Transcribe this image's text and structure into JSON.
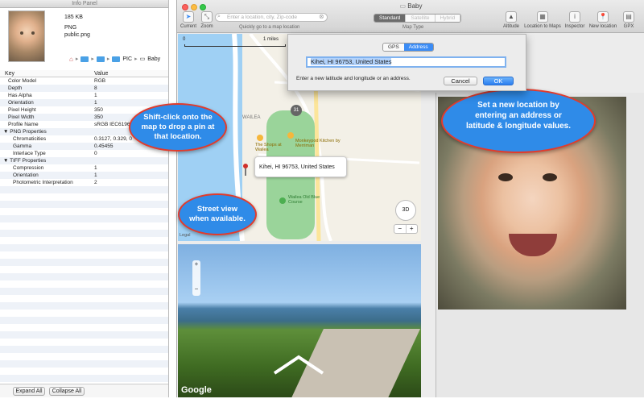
{
  "info_panel": {
    "title": "Info Panel",
    "file_size": "185 KB",
    "file_type": "PNG",
    "file_name": "public.png",
    "path": {
      "folder": "PIC",
      "file": "Baby"
    },
    "headers": {
      "key": "Key",
      "value": "Value"
    },
    "rows": [
      {
        "k": "Color Model",
        "v": "RGB",
        "indent": 1
      },
      {
        "k": "Depth",
        "v": "8",
        "indent": 1
      },
      {
        "k": "Has Alpha",
        "v": "1",
        "indent": 1
      },
      {
        "k": "Orientation",
        "v": "1",
        "indent": 1
      },
      {
        "k": "Pixel Height",
        "v": "350",
        "indent": 1
      },
      {
        "k": "Pixel Width",
        "v": "350",
        "indent": 1
      },
      {
        "k": "Profile Name",
        "v": "sRGB IEC6196",
        "indent": 1
      },
      {
        "k": "▼ PNG Properties",
        "v": "",
        "indent": 0
      },
      {
        "k": "Chromaticities",
        "v": "0.3127, 0.329, 0",
        "indent": 2
      },
      {
        "k": "Gamma",
        "v": "0.45455",
        "indent": 2
      },
      {
        "k": "Interlace Type",
        "v": "0",
        "indent": 2
      },
      {
        "k": "▼ TIFF Properties",
        "v": "",
        "indent": 0
      },
      {
        "k": "Compression",
        "v": "1",
        "indent": 2
      },
      {
        "k": "Orientation",
        "v": "1",
        "indent": 2
      },
      {
        "k": "Photometric Interpretation",
        "v": "2",
        "indent": 2
      }
    ],
    "expand_all": "Expand All",
    "collapse_all": "Collapse All"
  },
  "window": {
    "title": "Baby",
    "toolbar": {
      "current": "Current",
      "zoom": "Zoom",
      "search_placeholder": "Enter a location, city, Zip-code",
      "search_hint": "Quickly go to a map location",
      "map_type_label": "Map Type",
      "map_types": [
        "Standard",
        "Satellite",
        "Hybrid"
      ],
      "altitude": "Altitude",
      "location_to_maps": "Location to Maps",
      "inspector": "Inspector",
      "new_location": "New location",
      "gpx": "GPX"
    }
  },
  "map": {
    "scale_start": "0",
    "scale_end": "1 miles",
    "pin_label": "Kihei, HI  96753, United States",
    "places": [
      "WAILEA",
      "The Shops at Wailea",
      "Monkeypod Kitchen by Merriman",
      "Wailea Old Blue Course"
    ],
    "route_badge": "31",
    "view_3d": "3D",
    "zoom_minus": "−",
    "zoom_plus": "+",
    "legal": "Legal"
  },
  "street_view": {
    "logo": "Google"
  },
  "dialog": {
    "tabs": [
      "GPS",
      "Address"
    ],
    "address_value": "Kihei, HI  96753, United States",
    "hint": "Enter a new latitude and longitude or an address.",
    "cancel": "Cancel",
    "ok": "OK"
  },
  "bubbles": {
    "shift_click": "Shift-click onto the map to drop a pin at that location.",
    "street_view": "Street view when available.",
    "set_location": "Set a new location by entering an address or latitude & longitude values."
  },
  "colors": {
    "accent": "#3b8cf5",
    "bubble": "#2f8be8",
    "bubble_border": "#e23b2c"
  }
}
